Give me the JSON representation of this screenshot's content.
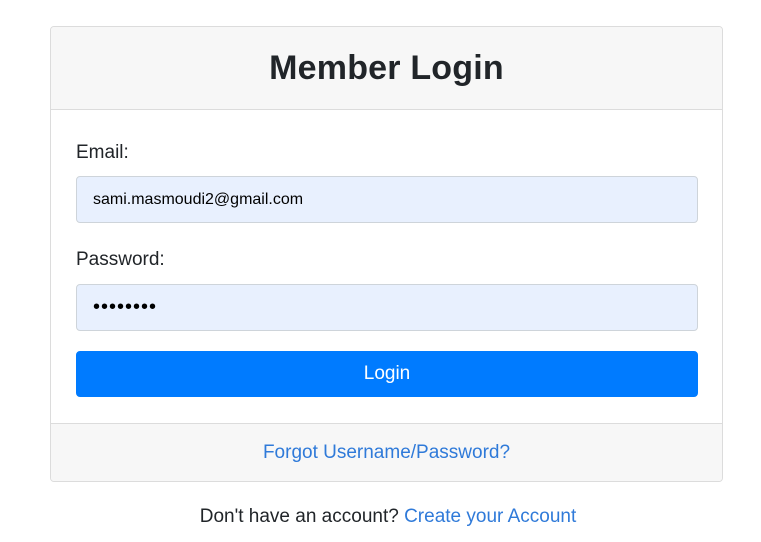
{
  "card": {
    "title": "Member Login"
  },
  "form": {
    "email_label": "Email:",
    "email_value": "sami.masmoudi2@gmail.com",
    "password_label": "Password:",
    "password_value": "••••••••",
    "login_label": "Login"
  },
  "footer": {
    "forgot_link": "Forgot Username/Password?"
  },
  "signup": {
    "prompt": "Don't have an account?",
    "link": "Create your Account"
  },
  "colors": {
    "accent": "#007bff",
    "link": "#2f7ad9",
    "input_bg": "#e8f0fe",
    "panel_bg": "#f7f7f7"
  }
}
